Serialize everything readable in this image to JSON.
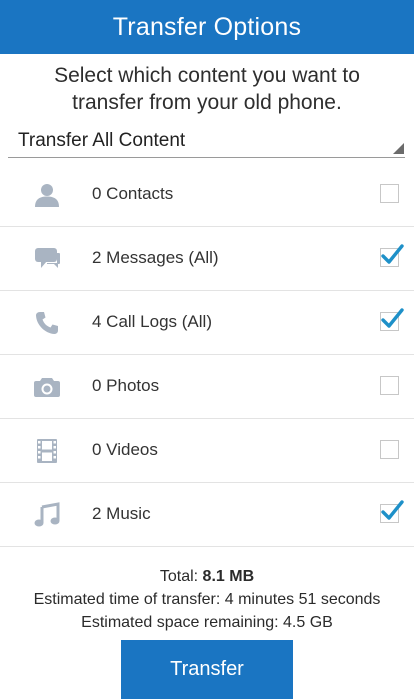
{
  "header": {
    "title": "Transfer Options"
  },
  "instructions": {
    "line1": "Select which content you want to",
    "line2": "transfer from your old phone."
  },
  "dropdown": {
    "selected": "Transfer All Content"
  },
  "items": [
    {
      "label": "0 Contacts",
      "icon": "contact-icon",
      "checked": false
    },
    {
      "label": "2 Messages (All)",
      "icon": "message-icon",
      "checked": true
    },
    {
      "label": "4 Call Logs (All)",
      "icon": "phone-icon",
      "checked": true
    },
    {
      "label": "0 Photos",
      "icon": "camera-icon",
      "checked": false
    },
    {
      "label": "0 Videos",
      "icon": "film-icon",
      "checked": false
    },
    {
      "label": "2 Music",
      "icon": "music-note-icon",
      "checked": true
    }
  ],
  "summary": {
    "total_label": "Total: ",
    "total_value": "8.1 MB",
    "time": "Estimated time of transfer: 4 minutes 51 seconds",
    "space": "Estimated space remaining: 4.5 GB"
  },
  "transfer_button": {
    "label": "Transfer"
  },
  "colors": {
    "accent": "#1a75c2",
    "icon_gray": "#a9b4c2",
    "check_blue": "#1e90c8"
  }
}
